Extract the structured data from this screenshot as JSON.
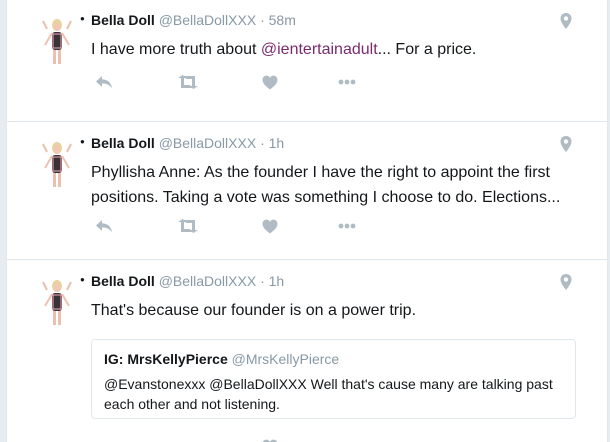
{
  "colors": {
    "text": "#14171a",
    "muted": "#8899a6",
    "mention": "#7a2b6e",
    "border": "#e1e8ed",
    "icon": "#b0bbc4"
  },
  "tweets": [
    {
      "name": "Bella Doll",
      "handle": "@BellaDollXXX",
      "dot": "·",
      "time": "58m",
      "text_before": "I have more truth about ",
      "mention": "@ientertainadult",
      "text_after": "... For a price."
    },
    {
      "name": "Bella Doll",
      "handle": "@BellaDollXXX",
      "dot": "·",
      "time": "1h",
      "text": "Phyllisha Anne: As the founder I have the right to appoint the first positions. Taking a vote was something I choose to do.  Elections..."
    },
    {
      "name": "Bella Doll",
      "handle": "@BellaDollXXX",
      "dot": "·",
      "time": "1h",
      "text": "That's because our founder is on a power trip.",
      "quote": {
        "name": "IG: MrsKellyPierce",
        "handle": "@MrsKellyPierce",
        "text": "@Evanstonexxx @BellaDollXXX Well that's cause many are talking past each other and not listening."
      }
    }
  ],
  "icons": [
    "reply-icon",
    "retweet-icon",
    "like-icon",
    "more-icon",
    "location-pin-icon",
    "avatar-image"
  ]
}
